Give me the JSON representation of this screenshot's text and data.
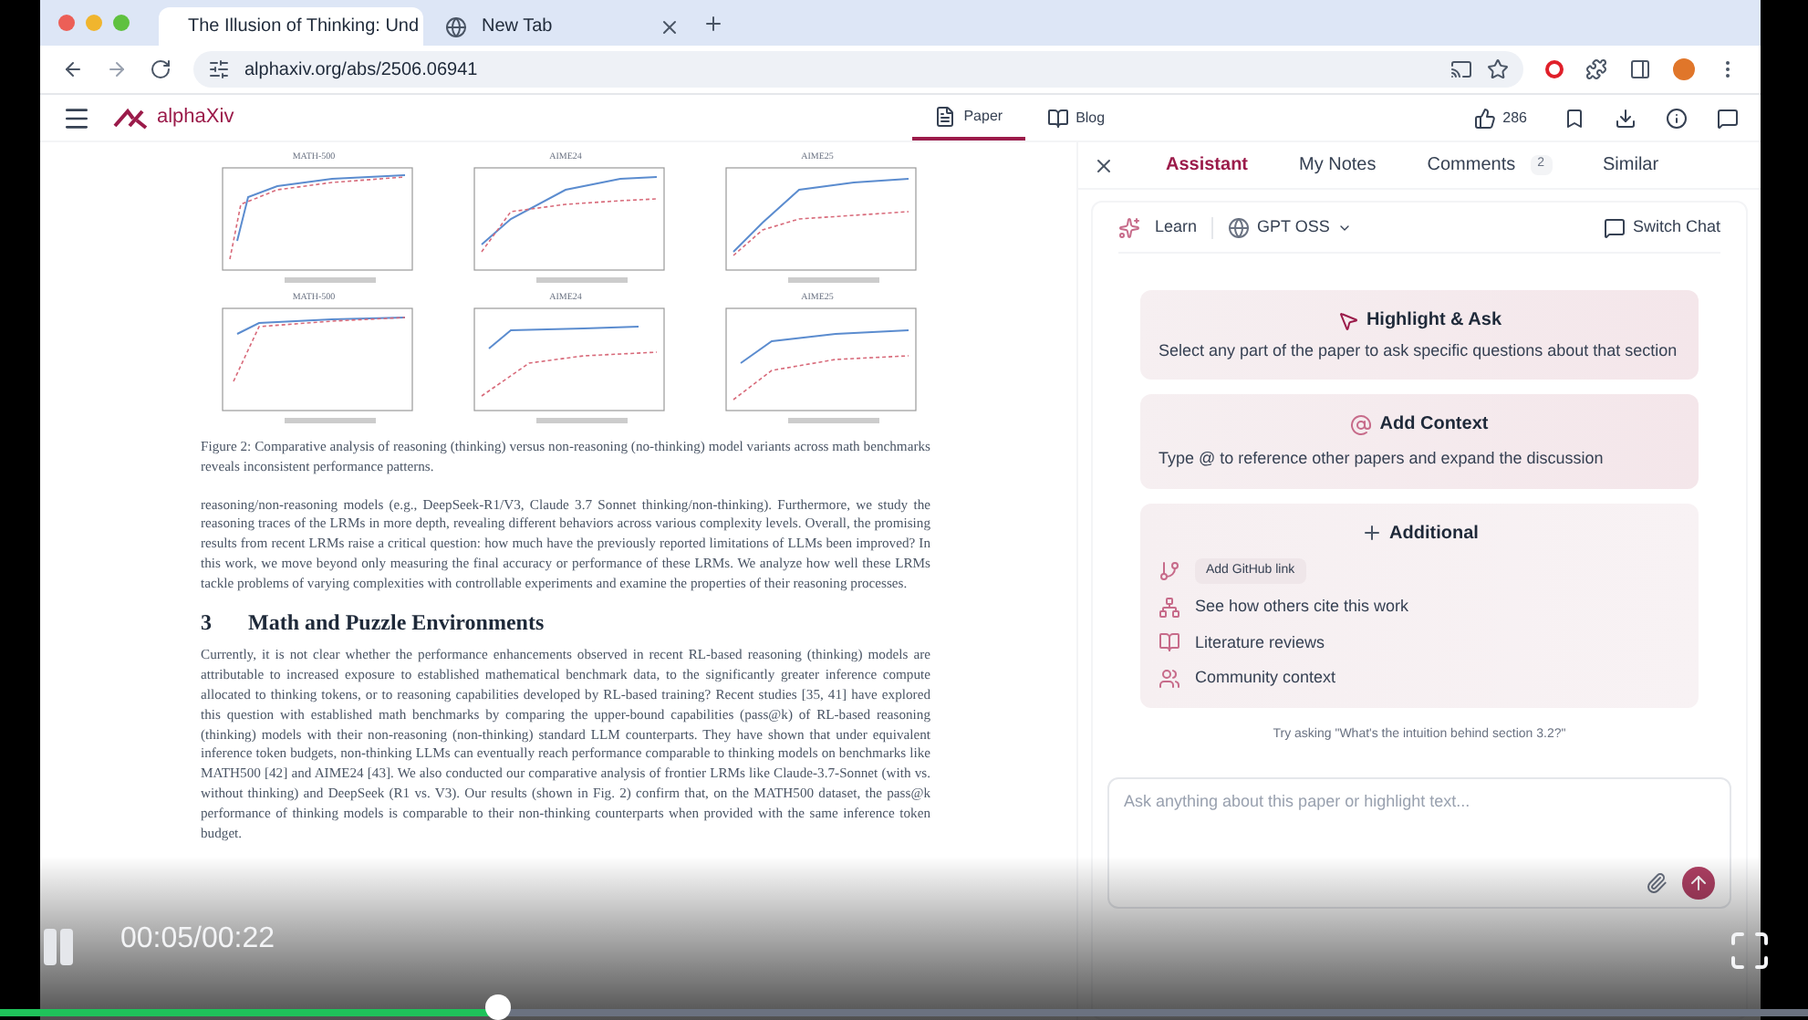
{
  "browser": {
    "tabs": [
      {
        "title": "The Illusion of Thinking: Und",
        "selected": true
      },
      {
        "title": "New Tab",
        "selected": false
      }
    ],
    "url": "alphaxiv.org/abs/2506.06941"
  },
  "header": {
    "logo": "alphaXiv",
    "tabs": [
      {
        "label": "Paper",
        "selected": true
      },
      {
        "label": "Blog",
        "selected": false
      }
    ],
    "likes": "286"
  },
  "paper": {
    "charts": [
      {
        "title": "MATH-500"
      },
      {
        "title": "AIME24"
      },
      {
        "title": "AIME25"
      },
      {
        "title": "MATH-500"
      },
      {
        "title": "AIME24"
      },
      {
        "title": "AIME25"
      }
    ],
    "caption": "Figure 2: Comparative analysis of reasoning (thinking) versus non-reasoning (no-thinking) model variants across math benchmarks reveals inconsistent performance patterns.",
    "paragraph_1": "reasoning/non-reasoning models (e.g., DeepSeek-R1/V3, Claude 3.7 Sonnet thinking/non-thinking). Furthermore, we study the reasoning traces of the LRMs in more depth, revealing different behaviors across various complexity levels. Overall, the promising results from recent LRMs raise a critical question: how much have the previously reported limitations of LLMs been improved? In this work, we move beyond only measuring the final accuracy or performance of these LRMs. We analyze how well these LRMs tackle problems of varying complexities with controllable experiments and examine the properties of their reasoning processes.",
    "section_number": "3",
    "section_title": "Math and Puzzle Environments",
    "paragraph_2": "Currently, it is not clear whether the performance enhancements observed in recent RL-based reasoning (thinking) models are attributable to increased exposure to established mathematical benchmark data, to the significantly greater inference compute allocated to thinking tokens, or to reasoning capabilities developed by RL-based training? Recent studies [35, 41] have explored this question with established math benchmarks by comparing the upper-bound capabilities (pass@k) of RL-based reasoning (thinking) models with their non-reasoning (non-thinking) standard LLM counterparts. They have shown that under equivalent inference token budgets, non-thinking LLMs can eventually reach performance comparable to thinking models on benchmarks like MATH500 [42] and AIME24 [43]. We also conducted our comparative analysis of frontier LRMs like Claude-3.7-Sonnet (with vs. without thinking) and DeepSeek (R1 vs. V3). Our results (shown in Fig. 2) confirm that, on the MATH500 dataset, the pass@k performance of thinking models is comparable to their non-thinking counterparts when provided with the same inference token budget."
  },
  "panel": {
    "tabs": [
      {
        "label": "Assistant",
        "selected": true
      },
      {
        "label": "My Notes",
        "selected": false
      },
      {
        "label": "Comments",
        "selected": false,
        "badge": "2"
      },
      {
        "label": "Similar",
        "selected": false
      }
    ],
    "mode": "Learn",
    "model": "GPT OSS",
    "switch_chat": "Switch Chat",
    "highlight_card": {
      "title": "Highlight & Ask",
      "description": "Select any part of the paper to ask specific questions about that section"
    },
    "context_card": {
      "title": "Add Context",
      "description": "Type @ to reference other papers and expand the discussion"
    },
    "additional_card": {
      "title": "Additional",
      "items": [
        {
          "kind": "chip",
          "label": "Add GitHub link"
        },
        {
          "kind": "link",
          "label": "See how others cite this work"
        },
        {
          "kind": "link",
          "label": "Literature reviews"
        },
        {
          "kind": "link",
          "label": "Community context"
        }
      ]
    },
    "hint": "Try asking \"What's the intuition behind section 3.2?\"",
    "input": {
      "placeholder": "Ask anything about this paper or highlight text..."
    }
  },
  "player": {
    "playing": true,
    "time": "00:05/00:22",
    "level": 0.275
  }
}
